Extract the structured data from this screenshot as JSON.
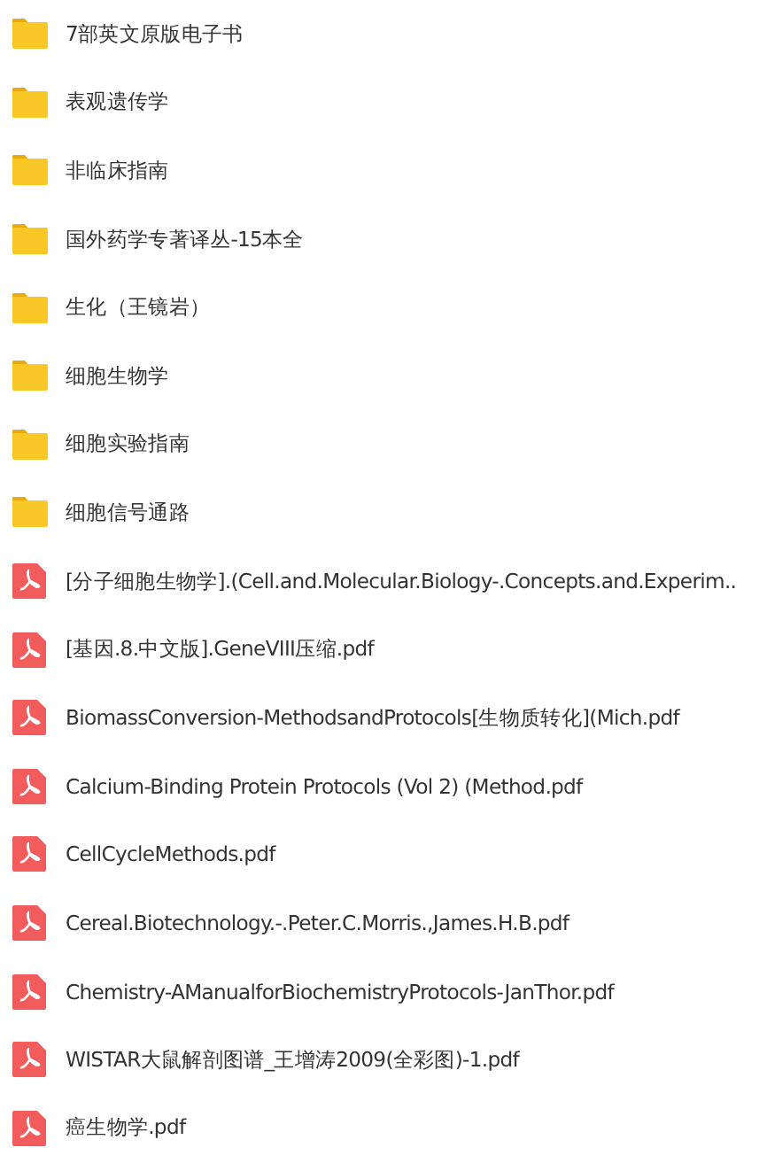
{
  "files": [
    {
      "kind": "folder",
      "name": "7部英文原版电子书"
    },
    {
      "kind": "folder",
      "name": "表观遗传学"
    },
    {
      "kind": "folder",
      "name": "非临床指南"
    },
    {
      "kind": "folder",
      "name": "国外药学专著译丛-15本全"
    },
    {
      "kind": "folder",
      "name": "生化（王镜岩）"
    },
    {
      "kind": "folder",
      "name": "细胞生物学"
    },
    {
      "kind": "folder",
      "name": "细胞实验指南"
    },
    {
      "kind": "folder",
      "name": "细胞信号通路"
    },
    {
      "kind": "pdf",
      "name": "[分子细胞生物学].(Cell.and.Molecular.Biology-.Concepts.and.Experim.."
    },
    {
      "kind": "pdf",
      "name": "[基因.8.中文版].GeneVIII压缩.pdf"
    },
    {
      "kind": "pdf",
      "name": "BiomassConversion-MethodsandProtocols[生物质转化](Mich.pdf"
    },
    {
      "kind": "pdf",
      "name": "Calcium-Binding Protein Protocols (Vol 2) (Method.pdf"
    },
    {
      "kind": "pdf",
      "name": "CellCycleMethods.pdf"
    },
    {
      "kind": "pdf",
      "name": "Cereal.Biotechnology.-.Peter.C.Morris.,James.H.B.pdf"
    },
    {
      "kind": "pdf",
      "name": "Chemistry-AManualforBiochemistryProtocols-JanThor.pdf"
    },
    {
      "kind": "pdf",
      "name": "WISTAR大鼠解剖图谱_王增涛2009(全彩图)-1.pdf"
    },
    {
      "kind": "pdf",
      "name": "癌生物学.pdf"
    }
  ]
}
